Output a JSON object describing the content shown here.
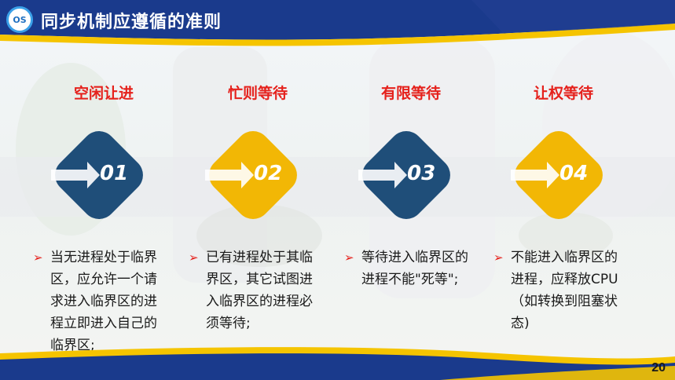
{
  "slide": {
    "logo_text": "OS",
    "title": "同步机制应遵循的准则",
    "page_number": "20"
  },
  "principles": [
    {
      "title": "空闲让进",
      "number": "01",
      "badge_color": "#1f4e79",
      "description": "当无进程处于临界区，应允许一个请求进入临界区的进程立即进入自己的临界区;"
    },
    {
      "title": "忙则等待",
      "number": "02",
      "badge_color": "#f2b705",
      "description": "已有进程处于其临界区，其它试图进入临界区的进程必须等待;"
    },
    {
      "title": "有限等待",
      "number": "03",
      "badge_color": "#1f4e79",
      "description": "等待进入临界区的进程不能\"死等\";"
    },
    {
      "title": "让权等待",
      "number": "04",
      "badge_color": "#f2b705",
      "description": "不能进入临界区的进程，应释放CPU（如转换到阻塞状态)"
    }
  ],
  "colors": {
    "header_blue": "#1a3a8c",
    "accent_yellow": "#f5c400",
    "title_red": "#e5211c",
    "badge_blue": "#1f4e79",
    "badge_yellow": "#f2b705"
  },
  "icons": {
    "bullet": "red-triangle-arrow",
    "badge_arrow": "right-arrow"
  }
}
